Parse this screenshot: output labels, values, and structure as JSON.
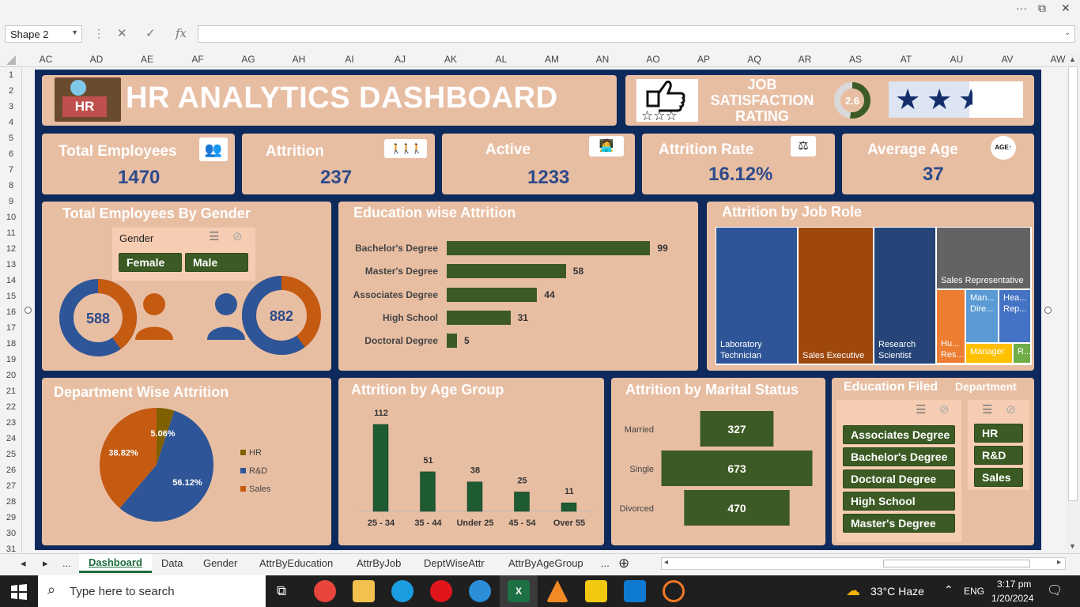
{
  "window": {
    "controls": [
      "···",
      "⧉",
      "✕"
    ]
  },
  "formula": {
    "name_box": "Shape 2",
    "fx": "fx",
    "value": ""
  },
  "columns": [
    "AC",
    "AD",
    "AE",
    "AF",
    "AG",
    "AH",
    "AI",
    "AJ",
    "AK",
    "AL",
    "AM",
    "AN",
    "AO",
    "AP",
    "AQ",
    "AR",
    "AS",
    "AT",
    "AU",
    "AV",
    "AW"
  ],
  "rows": [
    "1",
    "2",
    "3",
    "4",
    "5",
    "6",
    "7",
    "8",
    "9",
    "10",
    "11",
    "12",
    "13",
    "14",
    "15",
    "16",
    "17",
    "18",
    "19",
    "20",
    "21",
    "22",
    "23",
    "24",
    "25",
    "26",
    "27",
    "28",
    "29",
    "30",
    "31"
  ],
  "header": {
    "logo_text": "HR",
    "title": "HR ANALYTICS DASHBOARD",
    "job_sat_title": "JOB SATISFACTION RATING",
    "job_sat_value": "2.6",
    "job_sat_fraction": 0.52,
    "stars": [
      "★",
      "★",
      "★"
    ]
  },
  "kpis": [
    {
      "label": "Total Employees",
      "value": "1470",
      "icon": "people-group-icon"
    },
    {
      "label": "Attrition",
      "value": "237",
      "icon": "people-leaving-icon"
    },
    {
      "label": "Active",
      "value": "1233",
      "icon": "person-at-desk-icon"
    },
    {
      "label": "Attrition Rate",
      "value": "16.12%",
      "icon": "balance-person-icon"
    },
    {
      "label": "Average Age",
      "value": "37",
      "icon": "age-icon"
    }
  ],
  "gender": {
    "title": "Total Employees By Gender",
    "slicer_title": "Gender",
    "options": [
      "Female",
      "Male"
    ],
    "female": "588",
    "male": "882",
    "female_fraction": 0.4,
    "male_fraction": 0.6
  },
  "education_attrition": {
    "title": "Education wise Attrition"
  },
  "job_role": {
    "title": "Attrition by Job Role",
    "tiles": [
      "Laboratory Technician",
      "Sales Executive",
      "Research Scientist",
      "Sales Representative",
      "Hu... Res...",
      "Man... Dire...",
      "Hea... Rep...",
      "Manager",
      "R..."
    ]
  },
  "department": {
    "title": "Department Wise Attrition",
    "legend": [
      "HR",
      "R&D",
      "Sales"
    ]
  },
  "age_group": {
    "title": "Attrition by Age Group"
  },
  "marital": {
    "title": "Attrition by Marital Status"
  },
  "education_slicer": {
    "title": "Education Filed",
    "options": [
      "Associates Degree",
      "Bachelor's Degree",
      "Doctoral Degree",
      "High School",
      "Master's Degree"
    ]
  },
  "department_slicer": {
    "title": "Department",
    "options": [
      "HR",
      "R&D",
      "Sales"
    ]
  },
  "tabs": {
    "items": [
      "Dashboard",
      "Data",
      "Gender",
      "AttrByEducation",
      "AttrByJob",
      "DeptWiseAttr",
      "AttrByAgeGroup"
    ],
    "more_left": "...",
    "more_right": "...",
    "add": "⊕"
  },
  "taskbar": {
    "search_placeholder": "Type here to search",
    "weather": "33°C  Haze",
    "lang": "ENG",
    "time": "3:17 pm",
    "date": "1/20/2024"
  },
  "colors": {
    "navy": "#0e2a5c",
    "panel": "#e8bea3",
    "green": "#3c5b24",
    "blue": "#2e5597",
    "orange": "#c55a11",
    "hr": "#7f6000"
  },
  "chart_data": [
    {
      "type": "bar",
      "title": "Education wise Attrition",
      "categories": [
        "Bachelor's Degree",
        "Master's Degree",
        "Associates Degree",
        "High School",
        "Doctoral Degree"
      ],
      "values": [
        99,
        58,
        44,
        31,
        5
      ]
    },
    {
      "type": "pie",
      "title": "Department Wise Attrition",
      "categories": [
        "HR",
        "R&D",
        "Sales"
      ],
      "values": [
        5.06,
        56.12,
        38.82
      ],
      "labels": [
        "5.06%",
        "56.12%",
        "38.82%"
      ]
    },
    {
      "type": "bar",
      "title": "Attrition by Age Group",
      "categories": [
        "25 - 34",
        "35 - 44",
        "Under 25",
        "45 - 54",
        "Over 55"
      ],
      "values": [
        112,
        51,
        38,
        25,
        11
      ]
    },
    {
      "type": "bar",
      "title": "Attrition by Marital Status",
      "categories": [
        "Married",
        "Single",
        "Divorced"
      ],
      "values": [
        327,
        673,
        470
      ]
    }
  ]
}
